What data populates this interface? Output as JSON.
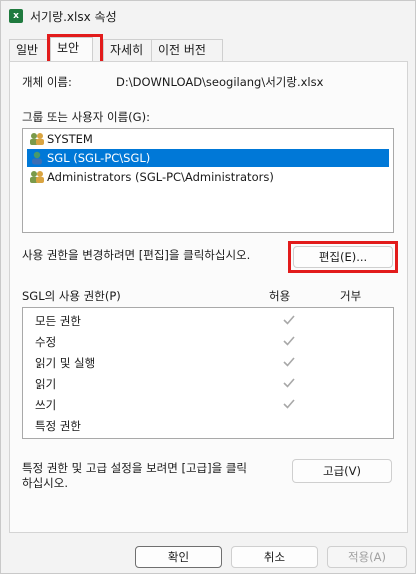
{
  "window": {
    "title": "서기랑.xlsx 속성",
    "icon": "excel-file-icon"
  },
  "tabs": [
    {
      "label": "일반"
    },
    {
      "label": "보안",
      "active": true
    },
    {
      "label": "자세히"
    },
    {
      "label": "이전 버전"
    }
  ],
  "object": {
    "label": "개체 이름:",
    "value": "D:\\DOWNLOAD\\seogilang\\서기랑.xlsx"
  },
  "groups": {
    "label": "그룹 또는 사용자 이름(G):",
    "items": [
      {
        "name": "SYSTEM",
        "icon": "users-icon"
      },
      {
        "name": "SGL (SGL-PC\\SGL)",
        "icon": "user-icon",
        "selected": true
      },
      {
        "name": "Administrators (SGL-PC\\Administrators)",
        "icon": "users-icon"
      }
    ]
  },
  "change_perms": {
    "text": "사용 권한을 변경하려면 [편집]을 클릭하십시오.",
    "edit_button": "편집(E)..."
  },
  "perms": {
    "label": "SGL의 사용 권한(P)",
    "allow_header": "허용",
    "deny_header": "거부",
    "rows": [
      {
        "name": "모든 권한",
        "allow": true
      },
      {
        "name": "수정",
        "allow": true
      },
      {
        "name": "읽기 및 실행",
        "allow": true
      },
      {
        "name": "읽기",
        "allow": true
      },
      {
        "name": "쓰기",
        "allow": true
      },
      {
        "name": "특정 권한",
        "allow": false
      }
    ]
  },
  "advanced": {
    "text_line1": "특정 권한 및 고급 설정을 보려면 [고급]을 클릭",
    "text_line2": "하십시오.",
    "button": "고급(V)"
  },
  "footer": {
    "ok": "확인",
    "cancel": "취소",
    "apply": "적용(A)"
  }
}
